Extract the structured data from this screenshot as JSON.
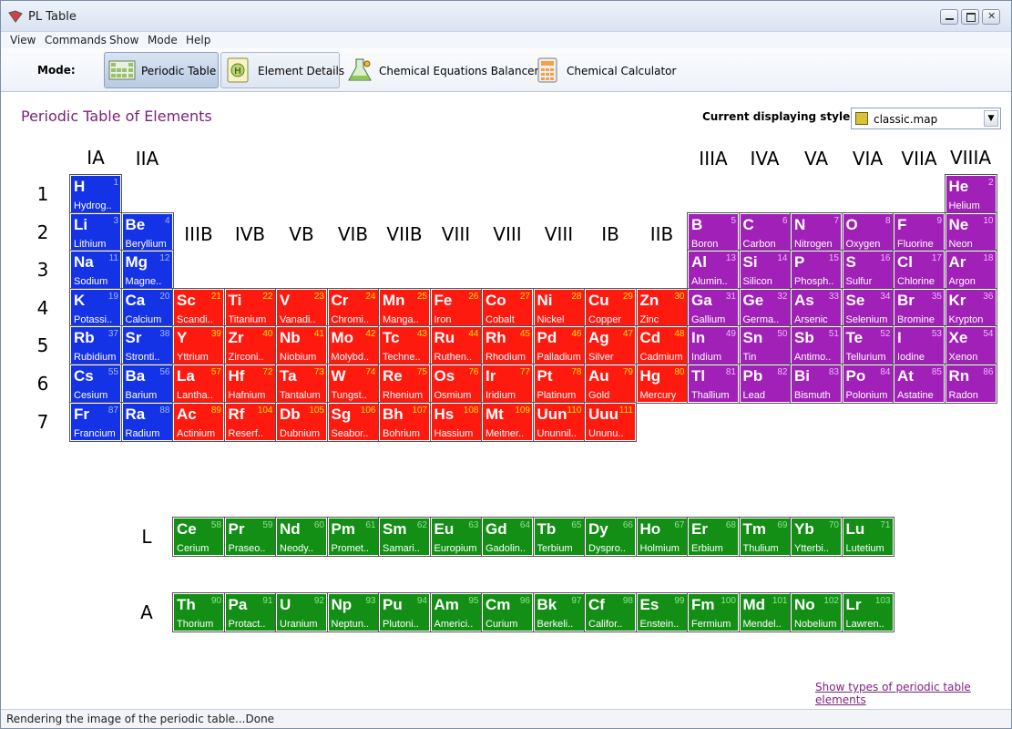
{
  "window": {
    "title": "PL Table"
  },
  "menu": [
    "View",
    "Commands",
    "Show",
    "Mode",
    "Help"
  ],
  "toolbar": {
    "mode_label": "Mode:",
    "modes": [
      {
        "label": "Periodic Table",
        "state": "active",
        "icon": "periodic-table-icon"
      },
      {
        "label": "Element Details",
        "state": "hover",
        "icon": "element-details-icon"
      },
      {
        "label": "Chemical Equations Balancer",
        "state": "normal",
        "icon": "flask-icon"
      },
      {
        "label": "Chemical Calculator",
        "state": "normal",
        "icon": "calculator-icon"
      }
    ]
  },
  "content": {
    "title": "Periodic Table of Elements",
    "style_label": "Current displaying style:",
    "style_value": "classic.map",
    "groups": [
      "IA",
      "IIA",
      "IIIB",
      "IVB",
      "VB",
      "VIB",
      "VIIB",
      "VIII",
      "VIII",
      "VIII",
      "IB",
      "IIB",
      "IIIA",
      "IVA",
      "VA",
      "VIA",
      "VIIA",
      "VIIIA"
    ],
    "periods": [
      "1",
      "2",
      "3",
      "4",
      "5",
      "6",
      "7"
    ],
    "series_labels": [
      "L",
      "A"
    ],
    "show_types_link": "Show types of periodic table elements"
  },
  "colors": {
    "s_block": "#1432e6",
    "d_block": "#ff1a10",
    "p_block": "#a020b8",
    "f_block": "#128f14"
  },
  "elements": [
    {
      "s": "H",
      "n": 1,
      "name": "Hydrog..",
      "r": 1,
      "c": 1,
      "cat": "s"
    },
    {
      "s": "He",
      "n": 2,
      "name": "Helium",
      "r": 1,
      "c": 18,
      "cat": "p"
    },
    {
      "s": "Li",
      "n": 3,
      "name": "Lithium",
      "r": 2,
      "c": 1,
      "cat": "s"
    },
    {
      "s": "Be",
      "n": 4,
      "name": "Beryllium",
      "r": 2,
      "c": 2,
      "cat": "s"
    },
    {
      "s": "B",
      "n": 5,
      "name": "Boron",
      "r": 2,
      "c": 13,
      "cat": "p"
    },
    {
      "s": "C",
      "n": 6,
      "name": "Carbon",
      "r": 2,
      "c": 14,
      "cat": "p"
    },
    {
      "s": "N",
      "n": 7,
      "name": "Nitrogen",
      "r": 2,
      "c": 15,
      "cat": "p"
    },
    {
      "s": "O",
      "n": 8,
      "name": "Oxygen",
      "r": 2,
      "c": 16,
      "cat": "p"
    },
    {
      "s": "F",
      "n": 9,
      "name": "Fluorine",
      "r": 2,
      "c": 17,
      "cat": "p"
    },
    {
      "s": "Ne",
      "n": 10,
      "name": "Neon",
      "r": 2,
      "c": 18,
      "cat": "p"
    },
    {
      "s": "Na",
      "n": 11,
      "name": "Sodium",
      "r": 3,
      "c": 1,
      "cat": "s"
    },
    {
      "s": "Mg",
      "n": 12,
      "name": "Magne..",
      "r": 3,
      "c": 2,
      "cat": "s"
    },
    {
      "s": "Al",
      "n": 13,
      "name": "Alumin..",
      "r": 3,
      "c": 13,
      "cat": "p"
    },
    {
      "s": "Si",
      "n": 14,
      "name": "Silicon",
      "r": 3,
      "c": 14,
      "cat": "p"
    },
    {
      "s": "P",
      "n": 15,
      "name": "Phosph..",
      "r": 3,
      "c": 15,
      "cat": "p"
    },
    {
      "s": "S",
      "n": 16,
      "name": "Sulfur",
      "r": 3,
      "c": 16,
      "cat": "p"
    },
    {
      "s": "Cl",
      "n": 17,
      "name": "Chlorine",
      "r": 3,
      "c": 17,
      "cat": "p"
    },
    {
      "s": "Ar",
      "n": 18,
      "name": "Argon",
      "r": 3,
      "c": 18,
      "cat": "p"
    },
    {
      "s": "K",
      "n": 19,
      "name": "Potassi..",
      "r": 4,
      "c": 1,
      "cat": "s"
    },
    {
      "s": "Ca",
      "n": 20,
      "name": "Calcium",
      "r": 4,
      "c": 2,
      "cat": "s"
    },
    {
      "s": "Sc",
      "n": 21,
      "name": "Scandi..",
      "r": 4,
      "c": 3,
      "cat": "d"
    },
    {
      "s": "Ti",
      "n": 22,
      "name": "Titanium",
      "r": 4,
      "c": 4,
      "cat": "d"
    },
    {
      "s": "V",
      "n": 23,
      "name": "Vanadi..",
      "r": 4,
      "c": 5,
      "cat": "d"
    },
    {
      "s": "Cr",
      "n": 24,
      "name": "Chromi..",
      "r": 4,
      "c": 6,
      "cat": "d"
    },
    {
      "s": "Mn",
      "n": 25,
      "name": "Manga..",
      "r": 4,
      "c": 7,
      "cat": "d"
    },
    {
      "s": "Fe",
      "n": 26,
      "name": "Iron",
      "r": 4,
      "c": 8,
      "cat": "d"
    },
    {
      "s": "Co",
      "n": 27,
      "name": "Cobalt",
      "r": 4,
      "c": 9,
      "cat": "d"
    },
    {
      "s": "Ni",
      "n": 28,
      "name": "Nickel",
      "r": 4,
      "c": 10,
      "cat": "d"
    },
    {
      "s": "Cu",
      "n": 29,
      "name": "Copper",
      "r": 4,
      "c": 11,
      "cat": "d"
    },
    {
      "s": "Zn",
      "n": 30,
      "name": "Zinc",
      "r": 4,
      "c": 12,
      "cat": "d"
    },
    {
      "s": "Ga",
      "n": 31,
      "name": "Gallium",
      "r": 4,
      "c": 13,
      "cat": "p"
    },
    {
      "s": "Ge",
      "n": 32,
      "name": "Germa..",
      "r": 4,
      "c": 14,
      "cat": "p"
    },
    {
      "s": "As",
      "n": 33,
      "name": "Arsenic",
      "r": 4,
      "c": 15,
      "cat": "p"
    },
    {
      "s": "Se",
      "n": 34,
      "name": "Selenium",
      "r": 4,
      "c": 16,
      "cat": "p"
    },
    {
      "s": "Br",
      "n": 35,
      "name": "Bromine",
      "r": 4,
      "c": 17,
      "cat": "p"
    },
    {
      "s": "Kr",
      "n": 36,
      "name": "Krypton",
      "r": 4,
      "c": 18,
      "cat": "p"
    },
    {
      "s": "Rb",
      "n": 37,
      "name": "Rubidium",
      "r": 5,
      "c": 1,
      "cat": "s"
    },
    {
      "s": "Sr",
      "n": 38,
      "name": "Stronti..",
      "r": 5,
      "c": 2,
      "cat": "s"
    },
    {
      "s": "Y",
      "n": 39,
      "name": "Yttrium",
      "r": 5,
      "c": 3,
      "cat": "d"
    },
    {
      "s": "Zr",
      "n": 40,
      "name": "Zirconi..",
      "r": 5,
      "c": 4,
      "cat": "d"
    },
    {
      "s": "Nb",
      "n": 41,
      "name": "Niobium",
      "r": 5,
      "c": 5,
      "cat": "d"
    },
    {
      "s": "Mo",
      "n": 42,
      "name": "Molybd..",
      "r": 5,
      "c": 6,
      "cat": "d"
    },
    {
      "s": "Tc",
      "n": 43,
      "name": "Techne..",
      "r": 5,
      "c": 7,
      "cat": "d"
    },
    {
      "s": "Ru",
      "n": 44,
      "name": "Ruthen..",
      "r": 5,
      "c": 8,
      "cat": "d"
    },
    {
      "s": "Rh",
      "n": 45,
      "name": "Rhodium",
      "r": 5,
      "c": 9,
      "cat": "d"
    },
    {
      "s": "Pd",
      "n": 46,
      "name": "Palladium",
      "r": 5,
      "c": 10,
      "cat": "d"
    },
    {
      "s": "Ag",
      "n": 47,
      "name": "Silver",
      "r": 5,
      "c": 11,
      "cat": "d"
    },
    {
      "s": "Cd",
      "n": 48,
      "name": "Cadmium",
      "r": 5,
      "c": 12,
      "cat": "d"
    },
    {
      "s": "In",
      "n": 49,
      "name": "Indium",
      "r": 5,
      "c": 13,
      "cat": "p"
    },
    {
      "s": "Sn",
      "n": 50,
      "name": "Tin",
      "r": 5,
      "c": 14,
      "cat": "p"
    },
    {
      "s": "Sb",
      "n": 51,
      "name": "Antimo..",
      "r": 5,
      "c": 15,
      "cat": "p"
    },
    {
      "s": "Te",
      "n": 52,
      "name": "Tellurium",
      "r": 5,
      "c": 16,
      "cat": "p"
    },
    {
      "s": "I",
      "n": 53,
      "name": "Iodine",
      "r": 5,
      "c": 17,
      "cat": "p"
    },
    {
      "s": "Xe",
      "n": 54,
      "name": "Xenon",
      "r": 5,
      "c": 18,
      "cat": "p"
    },
    {
      "s": "Cs",
      "n": 55,
      "name": "Cesium",
      "r": 6,
      "c": 1,
      "cat": "s"
    },
    {
      "s": "Ba",
      "n": 56,
      "name": "Barium",
      "r": 6,
      "c": 2,
      "cat": "s"
    },
    {
      "s": "La",
      "n": 57,
      "name": "Lantha..",
      "r": 6,
      "c": 3,
      "cat": "d"
    },
    {
      "s": "Hf",
      "n": 72,
      "name": "Hafnium",
      "r": 6,
      "c": 4,
      "cat": "d"
    },
    {
      "s": "Ta",
      "n": 73,
      "name": "Tantalum",
      "r": 6,
      "c": 5,
      "cat": "d"
    },
    {
      "s": "W",
      "n": 74,
      "name": "Tungst..",
      "r": 6,
      "c": 6,
      "cat": "d"
    },
    {
      "s": "Re",
      "n": 75,
      "name": "Rhenium",
      "r": 6,
      "c": 7,
      "cat": "d"
    },
    {
      "s": "Os",
      "n": 76,
      "name": "Osmium",
      "r": 6,
      "c": 8,
      "cat": "d"
    },
    {
      "s": "Ir",
      "n": 77,
      "name": "Iridium",
      "r": 6,
      "c": 9,
      "cat": "d"
    },
    {
      "s": "Pt",
      "n": 78,
      "name": "Platinum",
      "r": 6,
      "c": 10,
      "cat": "d"
    },
    {
      "s": "Au",
      "n": 79,
      "name": "Gold",
      "r": 6,
      "c": 11,
      "cat": "d"
    },
    {
      "s": "Hg",
      "n": 80,
      "name": "Mercury",
      "r": 6,
      "c": 12,
      "cat": "d"
    },
    {
      "s": "Tl",
      "n": 81,
      "name": "Thallium",
      "r": 6,
      "c": 13,
      "cat": "p"
    },
    {
      "s": "Pb",
      "n": 82,
      "name": "Lead",
      "r": 6,
      "c": 14,
      "cat": "p"
    },
    {
      "s": "Bi",
      "n": 83,
      "name": "Bismuth",
      "r": 6,
      "c": 15,
      "cat": "p"
    },
    {
      "s": "Po",
      "n": 84,
      "name": "Polonium",
      "r": 6,
      "c": 16,
      "cat": "p"
    },
    {
      "s": "At",
      "n": 85,
      "name": "Astatine",
      "r": 6,
      "c": 17,
      "cat": "p"
    },
    {
      "s": "Rn",
      "n": 86,
      "name": "Radon",
      "r": 6,
      "c": 18,
      "cat": "p"
    },
    {
      "s": "Fr",
      "n": 87,
      "name": "Francium",
      "r": 7,
      "c": 1,
      "cat": "s"
    },
    {
      "s": "Ra",
      "n": 88,
      "name": "Radium",
      "r": 7,
      "c": 2,
      "cat": "s"
    },
    {
      "s": "Ac",
      "n": 89,
      "name": "Actinium",
      "r": 7,
      "c": 3,
      "cat": "d"
    },
    {
      "s": "Rf",
      "n": 104,
      "name": "Reserf..",
      "r": 7,
      "c": 4,
      "cat": "d"
    },
    {
      "s": "Db",
      "n": 105,
      "name": "Dubnium",
      "r": 7,
      "c": 5,
      "cat": "d"
    },
    {
      "s": "Sg",
      "n": 106,
      "name": "Seabor..",
      "r": 7,
      "c": 6,
      "cat": "d"
    },
    {
      "s": "Bh",
      "n": 107,
      "name": "Bohrium",
      "r": 7,
      "c": 7,
      "cat": "d"
    },
    {
      "s": "Hs",
      "n": 108,
      "name": "Hassium",
      "r": 7,
      "c": 8,
      "cat": "d"
    },
    {
      "s": "Mt",
      "n": 109,
      "name": "Meitner..",
      "r": 7,
      "c": 9,
      "cat": "d"
    },
    {
      "s": "Uun",
      "n": 110,
      "name": "Ununnil..",
      "r": 7,
      "c": 10,
      "cat": "d"
    },
    {
      "s": "Uuu",
      "n": 111,
      "name": "Ununu..",
      "r": 7,
      "c": 11,
      "cat": "d"
    },
    {
      "s": "Ce",
      "n": 58,
      "name": "Cerium",
      "r": 9,
      "c": 3,
      "cat": "f"
    },
    {
      "s": "Pr",
      "n": 59,
      "name": "Praseo..",
      "r": 9,
      "c": 4,
      "cat": "f"
    },
    {
      "s": "Nd",
      "n": 60,
      "name": "Neody..",
      "r": 9,
      "c": 5,
      "cat": "f"
    },
    {
      "s": "Pm",
      "n": 61,
      "name": "Promet..",
      "r": 9,
      "c": 6,
      "cat": "f"
    },
    {
      "s": "Sm",
      "n": 62,
      "name": "Samari..",
      "r": 9,
      "c": 7,
      "cat": "f"
    },
    {
      "s": "Eu",
      "n": 63,
      "name": "Europium",
      "r": 9,
      "c": 8,
      "cat": "f"
    },
    {
      "s": "Gd",
      "n": 64,
      "name": "Gadolin..",
      "r": 9,
      "c": 9,
      "cat": "f"
    },
    {
      "s": "Tb",
      "n": 65,
      "name": "Terbium",
      "r": 9,
      "c": 10,
      "cat": "f"
    },
    {
      "s": "Dy",
      "n": 66,
      "name": "Dyspro..",
      "r": 9,
      "c": 11,
      "cat": "f"
    },
    {
      "s": "Ho",
      "n": 67,
      "name": "Holmium",
      "r": 9,
      "c": 12,
      "cat": "f"
    },
    {
      "s": "Er",
      "n": 68,
      "name": "Erbium",
      "r": 9,
      "c": 13,
      "cat": "f"
    },
    {
      "s": "Tm",
      "n": 69,
      "name": "Thulium",
      "r": 9,
      "c": 14,
      "cat": "f"
    },
    {
      "s": "Yb",
      "n": 70,
      "name": "Ytterbi..",
      "r": 9,
      "c": 15,
      "cat": "f"
    },
    {
      "s": "Lu",
      "n": 71,
      "name": "Lutetium",
      "r": 9,
      "c": 16,
      "cat": "f"
    },
    {
      "s": "Th",
      "n": 90,
      "name": "Thorium",
      "r": 10,
      "c": 3,
      "cat": "f"
    },
    {
      "s": "Pa",
      "n": 91,
      "name": "Protact..",
      "r": 10,
      "c": 4,
      "cat": "f"
    },
    {
      "s": "U",
      "n": 92,
      "name": "Uranium",
      "r": 10,
      "c": 5,
      "cat": "f"
    },
    {
      "s": "Np",
      "n": 93,
      "name": "Neptun..",
      "r": 10,
      "c": 6,
      "cat": "f"
    },
    {
      "s": "Pu",
      "n": 94,
      "name": "Plutoni..",
      "r": 10,
      "c": 7,
      "cat": "f"
    },
    {
      "s": "Am",
      "n": 95,
      "name": "Americi..",
      "r": 10,
      "c": 8,
      "cat": "f"
    },
    {
      "s": "Cm",
      "n": 96,
      "name": "Curium",
      "r": 10,
      "c": 9,
      "cat": "f"
    },
    {
      "s": "Bk",
      "n": 97,
      "name": "Berkeli..",
      "r": 10,
      "c": 10,
      "cat": "f"
    },
    {
      "s": "Cf",
      "n": 98,
      "name": "Califor..",
      "r": 10,
      "c": 11,
      "cat": "f"
    },
    {
      "s": "Es",
      "n": 99,
      "name": "Enstein..",
      "r": 10,
      "c": 12,
      "cat": "f"
    },
    {
      "s": "Fm",
      "n": 100,
      "name": "Fermium",
      "r": 10,
      "c": 13,
      "cat": "f"
    },
    {
      "s": "Md",
      "n": 101,
      "name": "Mendel..",
      "r": 10,
      "c": 14,
      "cat": "f"
    },
    {
      "s": "No",
      "n": 102,
      "name": "Nobelium",
      "r": 10,
      "c": 15,
      "cat": "f"
    },
    {
      "s": "Lr",
      "n": 103,
      "name": "Lawren..",
      "r": 10,
      "c": 16,
      "cat": "f"
    }
  ],
  "status": "Rendering the image of the periodic table...Done"
}
